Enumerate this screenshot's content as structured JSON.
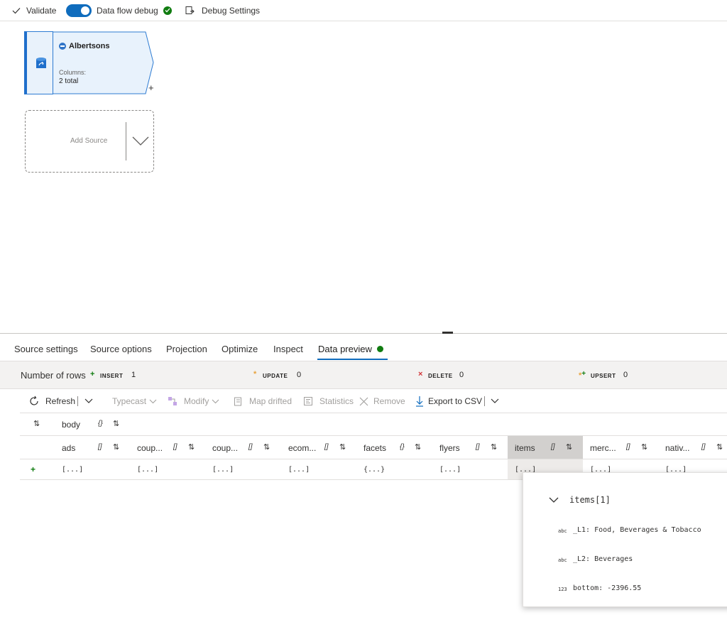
{
  "toolbar": {
    "validate": "Validate",
    "debug_label": "Data flow debug",
    "debug_settings": "Debug Settings"
  },
  "node": {
    "title": "Albertsons",
    "columns_label": "Columns:",
    "columns_value": "2 total",
    "plus": "+"
  },
  "add_source": {
    "label": "Add Source"
  },
  "tabs": [
    {
      "label": "Source settings"
    },
    {
      "label": "Source options"
    },
    {
      "label": "Projection"
    },
    {
      "label": "Optimize"
    },
    {
      "label": "Inspect"
    },
    {
      "label": "Data preview"
    }
  ],
  "stats": {
    "rows_label": "Number of rows",
    "insert_label": "INSERT",
    "insert_value": "1",
    "update_label": "UPDATE",
    "update_value": "0",
    "delete_label": "DELETE",
    "delete_value": "0",
    "upsert_label": "UPSERT",
    "upsert_value": "0"
  },
  "actions": {
    "refresh": "Refresh",
    "typecast": "Typecast",
    "modify": "Modify",
    "map_drifted": "Map drifted",
    "statistics": "Statistics",
    "remove": "Remove",
    "export_csv": "Export to CSV"
  },
  "grid": {
    "top_column": {
      "label": "body",
      "type": "{}"
    },
    "columns": [
      {
        "label": "ads",
        "type": "[]",
        "cell": "[...]"
      },
      {
        "label": "coup...",
        "type": "[]",
        "cell": "[...]"
      },
      {
        "label": "coup...",
        "type": "[]",
        "cell": "[...]"
      },
      {
        "label": "ecom...",
        "type": "[]",
        "cell": "[...]"
      },
      {
        "label": "facets",
        "type": "{}",
        "cell": "{...}"
      },
      {
        "label": "flyers",
        "type": "[]",
        "cell": "[...]"
      },
      {
        "label": "items",
        "type": "[]",
        "cell": "[...]"
      },
      {
        "label": "merc...",
        "type": "[]",
        "cell": "[...]"
      },
      {
        "label": "nativ...",
        "type": "[]",
        "cell": "[...]"
      }
    ],
    "row_marker": "+"
  },
  "popup": {
    "title": "items[1]",
    "items": [
      {
        "type": "abc",
        "text": "_L1: Food, Beverages & Tobacco"
      },
      {
        "type": "abc",
        "text": "_L2: Beverages"
      },
      {
        "type": "123",
        "text": "bottom: -2396.55"
      }
    ]
  }
}
